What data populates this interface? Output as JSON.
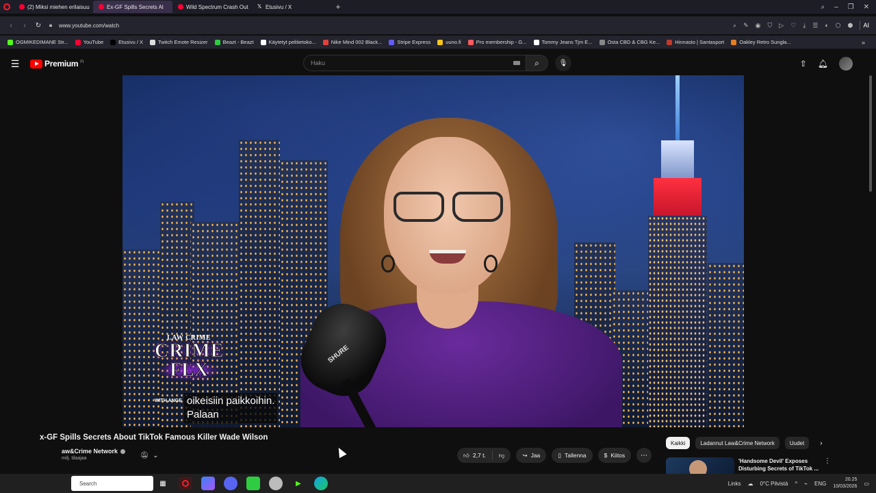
{
  "browser": {
    "tabs": [
      {
        "label": "(2) Miksi miehen erilaisuu",
        "icon": "yt",
        "active": false
      },
      {
        "label": "Ex-GF Spills Secrets Al",
        "icon": "yt",
        "active": true
      },
      {
        "label": "Wild Spectrum Crash Out",
        "icon": "yt",
        "active": false
      },
      {
        "label": "Etusivu / X",
        "icon": "x",
        "active": false
      }
    ],
    "new_tab": "+",
    "url": "www.youtube.com/watch",
    "ai_label": "AI",
    "bookmarks": [
      {
        "label": "OGMIKEDIMANE Str...",
        "color": "#53fc18"
      },
      {
        "label": "YouTube",
        "color": "#ff0033"
      },
      {
        "label": "Etusivu / X",
        "color": "#000000"
      },
      {
        "label": "Twitch Emote Resizer",
        "color": "#dddddd"
      },
      {
        "label": "Beazt - Beazt",
        "color": "#2ecc40"
      },
      {
        "label": "Käytetyt pelitietoko...",
        "color": "#ffffff"
      },
      {
        "label": "Nike Mind 002 Black...",
        "color": "#e0423b"
      },
      {
        "label": "Stripe Express",
        "color": "#635bff"
      },
      {
        "label": "uuno.fi",
        "color": "#f5c518"
      },
      {
        "label": "Pro membership - G...",
        "color": "#ff5a5f"
      },
      {
        "label": "Tommy Jeans Tjm E...",
        "color": "#ffffff"
      },
      {
        "label": "Osta CBD & CBG Ke...",
        "color": "#888888"
      },
      {
        "label": "Hinnasto | Santasport",
        "color": "#c0392b"
      },
      {
        "label": "Oakley Retro Sungla...",
        "color": "#e67e22"
      }
    ]
  },
  "youtube": {
    "brand": "Premium",
    "country": "FI",
    "search_placeholder": "Haku"
  },
  "video": {
    "overlay_logo": {
      "top": "LAW  CRIME",
      "crime": "CRIME",
      "flx": "FLX",
      "with": "WITH ANGE"
    },
    "captions": [
      "oikeisiin paikkoihin.",
      "Palaan"
    ],
    "mic_brand": "SHURE"
  },
  "info": {
    "title": "x-GF Spills Secrets About TikTok Famous Killer Wade Wilson",
    "channel": "aw&Crime Network",
    "subscribers": "milj. tilaajaa",
    "likes": "2,7 t.",
    "share_label": "Jaa",
    "save_label": "Tallenna",
    "thanks_label": "Kiitos",
    "chips": [
      "Kaikki",
      "Ladannut Law&Crime Network",
      "Uudet"
    ],
    "recommended_title": "'Handsome Devil' Exposes Disturbing Secrets of TikTok ..."
  },
  "taskbar": {
    "search": "Search",
    "links": "Links",
    "weather": "0°C  Pilvistä",
    "lang": "ENG",
    "time": "20.25",
    "date": "10/03/2026"
  }
}
